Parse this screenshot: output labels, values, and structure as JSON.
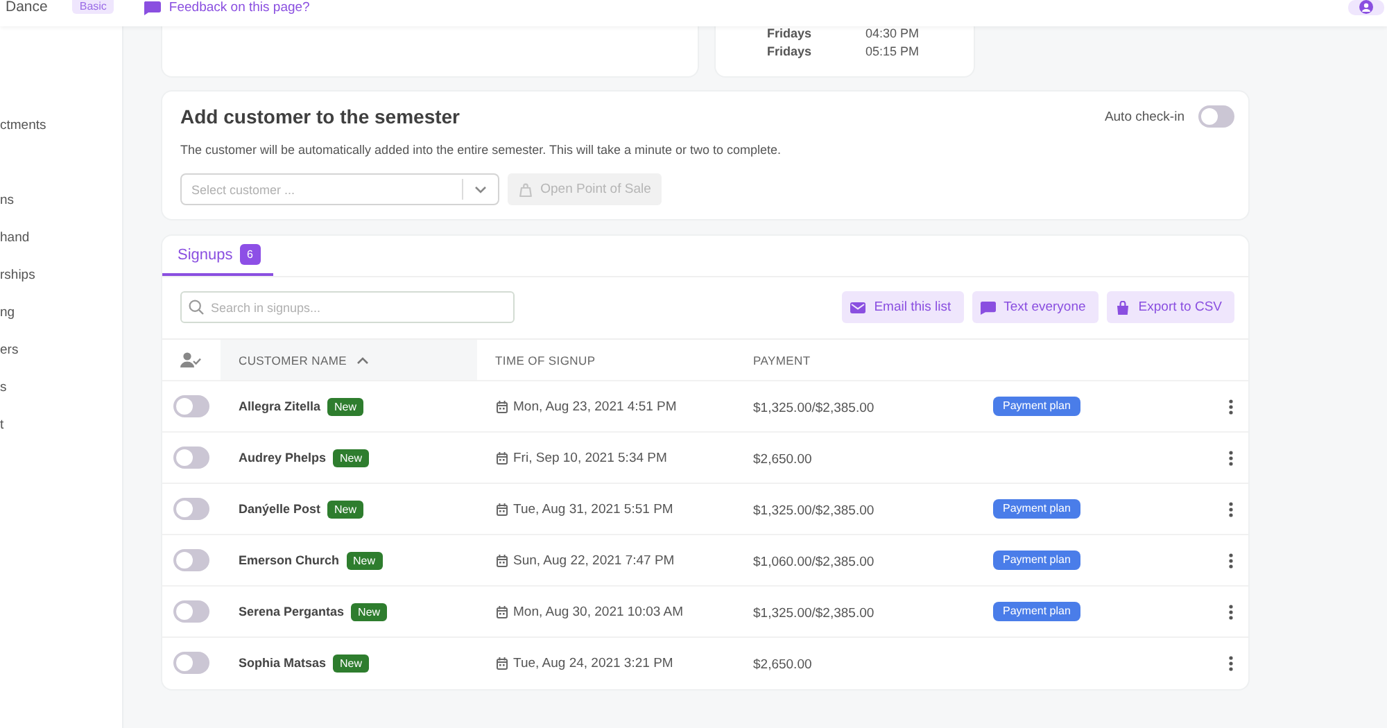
{
  "header": {
    "org_name": "Dance",
    "plan_badge": "Basic",
    "feedback_link": "Feedback on this page?"
  },
  "sidebar": {
    "groups": [
      {
        "items": [
          {
            "label": "ctments"
          }
        ]
      },
      {
        "items": [
          {
            "label": "ns"
          },
          {
            "label": "hand"
          },
          {
            "label": "rships"
          },
          {
            "label": "ng"
          },
          {
            "label": "ers"
          },
          {
            "label": "s"
          },
          {
            "label": "t"
          }
        ]
      }
    ]
  },
  "schedule": {
    "rows": [
      {
        "day": "Fridays",
        "time": "04:30 PM"
      },
      {
        "day": "Fridays",
        "time": "05:15 PM"
      }
    ]
  },
  "add_customer": {
    "title": "Add customer to the semester",
    "auto_checkin": {
      "label": "Auto check-in",
      "on": false
    },
    "description": "The customer will be automatically added into the entire semester. This will take a minute or two to complete.",
    "select": {
      "placeholder": "Select customer ..."
    },
    "pos_button": {
      "label": "Open Point of Sale",
      "disabled": true
    }
  },
  "signups": {
    "tabs": [
      {
        "label": "Signups",
        "count": "6",
        "selected": true
      }
    ],
    "search": {
      "placeholder": "Search in signups..."
    },
    "actions": [
      {
        "label": "Email this list"
      },
      {
        "label": "Text everyone"
      },
      {
        "label": "Export to CSV"
      }
    ],
    "table": {
      "columns": [
        {
          "label": "CUSTOMER NAME",
          "sorted": true,
          "ascending": true
        },
        {
          "label": "TIME OF SIGNUP",
          "sorted": false
        },
        {
          "label": "PAYMENT",
          "sorted": false
        }
      ],
      "rows": [
        {
          "checked_in": false,
          "name": "Allegra Zitella",
          "badge": "New",
          "time": "Mon, Aug 23, 2021 4:51 PM",
          "payment": "$1,325.00/$2,385.00",
          "payment_tag": "Payment plan"
        },
        {
          "checked_in": false,
          "name": "Audrey Phelps",
          "badge": "New",
          "time": "Fri, Sep 10, 2021 5:34 PM",
          "payment": "$2,650.00"
        },
        {
          "checked_in": false,
          "name": "Danýelle Post",
          "badge": "New",
          "time": "Tue, Aug 31, 2021 5:51 PM",
          "payment": "$1,325.00/$2,385.00",
          "payment_tag": "Payment plan"
        },
        {
          "checked_in": false,
          "name": "Emerson Church",
          "badge": "New",
          "time": "Sun, Aug 22, 2021 7:47 PM",
          "payment": "$1,060.00/$2,385.00",
          "payment_tag": "Payment plan"
        },
        {
          "checked_in": false,
          "name": "Serena Pergantas",
          "badge": "New",
          "time": "Mon, Aug 30, 2021 10:03 AM",
          "payment": "$1,325.00/$2,385.00",
          "payment_tag": "Payment plan"
        },
        {
          "checked_in": false,
          "name": "Sophia Matsas",
          "badge": "New",
          "time": "Tue, Aug 24, 2021 3:21 PM",
          "payment": "$2,650.00"
        }
      ]
    }
  }
}
